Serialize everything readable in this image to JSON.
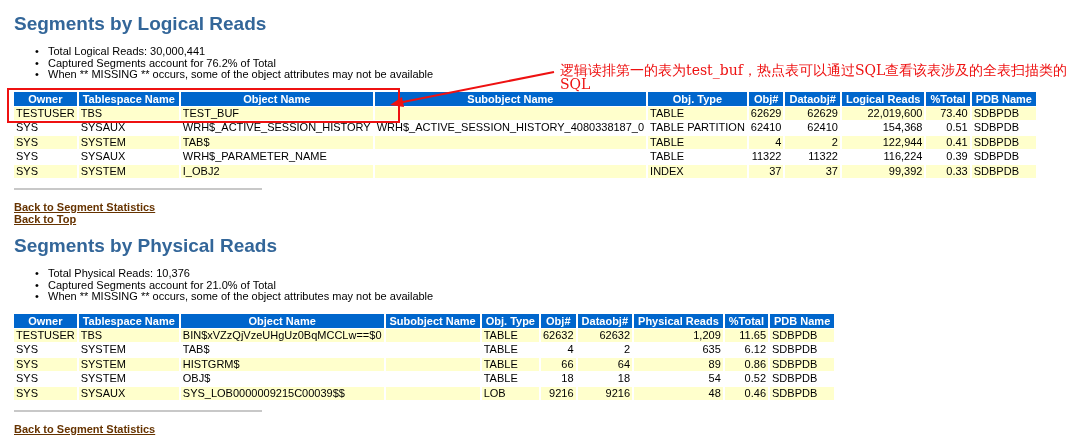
{
  "sections": [
    {
      "title": "Segments by Logical Reads",
      "marker": "•",
      "bullets": [
        "Total Logical Reads: 30,000,441",
        "Captured Segments account for 76.2% of Total",
        "When ** MISSING ** occurs, some of the object attributes may not be available"
      ],
      "table": {
        "columns": [
          {
            "label": "Owner",
            "kind": "text"
          },
          {
            "label": "Tablespace Name",
            "kind": "text"
          },
          {
            "label": "Object Name",
            "kind": "text"
          },
          {
            "label": "Subobject Name",
            "kind": "text"
          },
          {
            "label": "Obj. Type",
            "kind": "text"
          },
          {
            "label": "Obj#",
            "kind": "number"
          },
          {
            "label": "Dataobj#",
            "kind": "number"
          },
          {
            "label": "Logical Reads",
            "kind": "number"
          },
          {
            "label": "%Total",
            "kind": "number"
          },
          {
            "label": "PDB Name",
            "kind": "text"
          }
        ],
        "rows": [
          [
            "TESTUSER",
            "TBS",
            "TEST_BUF",
            "",
            "TABLE",
            "62629",
            "62629",
            "22,019,600",
            "73.40",
            "SDBPDB"
          ],
          [
            "SYS",
            "SYSAUX",
            "WRH$_ACTIVE_SESSION_HISTORY",
            "WRH$_ACTIVE_SESSION_HISTORY_4080338187_0",
            "TABLE PARTITION",
            "62410",
            "62410",
            "154,368",
            "0.51",
            "SDBPDB"
          ],
          [
            "SYS",
            "SYSTEM",
            "TAB$",
            "",
            "TABLE",
            "4",
            "2",
            "122,944",
            "0.41",
            "SDBPDB"
          ],
          [
            "SYS",
            "SYSAUX",
            "WRH$_PARAMETER_NAME",
            "",
            "TABLE",
            "11322",
            "11322",
            "116,224",
            "0.39",
            "SDBPDB"
          ],
          [
            "SYS",
            "SYSTEM",
            "I_OBJ2",
            "",
            "INDEX",
            "37",
            "37",
            "99,392",
            "0.33",
            "SDBPDB"
          ]
        ]
      },
      "links": [
        "Back to Segment Statistics",
        "Back to Top"
      ]
    },
    {
      "title": "Segments by Physical Reads",
      "marker": "•",
      "bullets": [
        "Total Physical Reads: 10,376",
        "Captured Segments account for 21.0% of Total",
        "When ** MISSING ** occurs, some of the object attributes may not be available"
      ],
      "table": {
        "columns": [
          {
            "label": "Owner",
            "kind": "text"
          },
          {
            "label": "Tablespace Name",
            "kind": "text"
          },
          {
            "label": "Object Name",
            "kind": "text"
          },
          {
            "label": "Subobject Name",
            "kind": "text"
          },
          {
            "label": "Obj. Type",
            "kind": "text"
          },
          {
            "label": "Obj#",
            "kind": "number"
          },
          {
            "label": "Dataobj#",
            "kind": "number"
          },
          {
            "label": "Physical Reads",
            "kind": "number"
          },
          {
            "label": "%Total",
            "kind": "number"
          },
          {
            "label": "PDB Name",
            "kind": "text"
          }
        ],
        "rows": [
          [
            "TESTUSER",
            "TBS",
            "BIN$xVZzQjVzeUHgUz0BqMCCLw==$0",
            "",
            "TABLE",
            "62632",
            "62632",
            "1,209",
            "11.65",
            "SDBPDB"
          ],
          [
            "SYS",
            "SYSTEM",
            "TAB$",
            "",
            "TABLE",
            "4",
            "2",
            "635",
            "6.12",
            "SDBPDB"
          ],
          [
            "SYS",
            "SYSTEM",
            "HISTGRM$",
            "",
            "TABLE",
            "66",
            "64",
            "89",
            "0.86",
            "SDBPDB"
          ],
          [
            "SYS",
            "SYSTEM",
            "OBJ$",
            "",
            "TABLE",
            "18",
            "18",
            "54",
            "0.52",
            "SDBPDB"
          ],
          [
            "SYS",
            "SYSAUX",
            "SYS_LOB0000009215C00039$$",
            "",
            "LOB",
            "9216",
            "9216",
            "48",
            "0.46",
            "SDBPDB"
          ]
        ]
      },
      "links": [
        "Back to Segment Statistics"
      ]
    }
  ],
  "annotation": {
    "text": "逻辑读排第一的表为test_buf，热点表可以通过SQL查看该表涉及的全表扫描类的SQL"
  }
}
